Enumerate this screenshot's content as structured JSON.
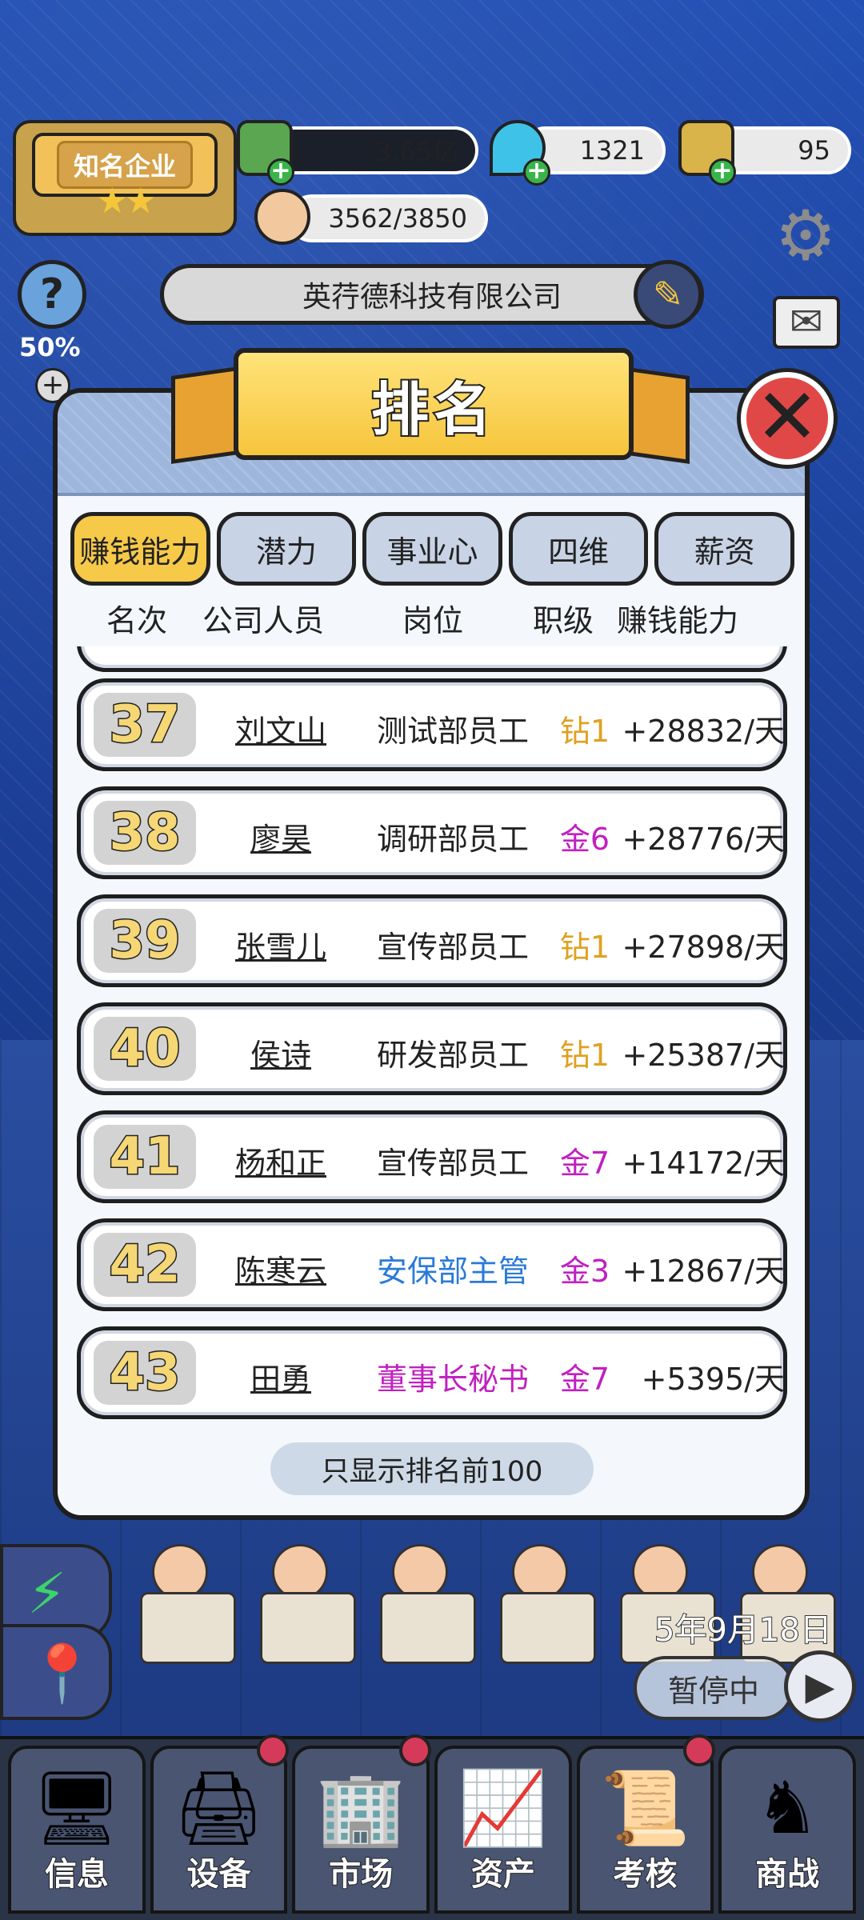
{
  "hud": {
    "company_rank_badge": "知名企业",
    "money": "3.65亿",
    "diamonds": "1321",
    "tickets": "95",
    "likes": "3562/3850",
    "company_name": "英荇德科技有限公司",
    "help_percent": "50%"
  },
  "modal": {
    "title": "排名",
    "tabs": [
      {
        "label": "赚钱能力",
        "active": true
      },
      {
        "label": "潜力",
        "active": false
      },
      {
        "label": "事业心",
        "active": false
      },
      {
        "label": "四维",
        "active": false
      },
      {
        "label": "薪资",
        "active": false
      }
    ],
    "columns": [
      "名次",
      "公司人员",
      "岗位",
      "职级",
      "赚钱能力"
    ],
    "rows": [
      {
        "rank": "37",
        "name": "刘文山",
        "position": "测试部员工",
        "position_color": "#222222",
        "grade": "钻1",
        "grade_color": "#e0a020",
        "earning": "+28832/天"
      },
      {
        "rank": "38",
        "name": "廖昊",
        "position": "调研部员工",
        "position_color": "#222222",
        "grade": "金6",
        "grade_color": "#c020c0",
        "earning": "+28776/天"
      },
      {
        "rank": "39",
        "name": "张雪儿",
        "position": "宣传部员工",
        "position_color": "#222222",
        "grade": "钻1",
        "grade_color": "#e0a020",
        "earning": "+27898/天"
      },
      {
        "rank": "40",
        "name": "侯诗",
        "position": "研发部员工",
        "position_color": "#222222",
        "grade": "钻1",
        "grade_color": "#e0a020",
        "earning": "+25387/天"
      },
      {
        "rank": "41",
        "name": "杨和正",
        "position": "宣传部员工",
        "position_color": "#222222",
        "grade": "金7",
        "grade_color": "#c020c0",
        "earning": "+14172/天"
      },
      {
        "rank": "42",
        "name": "陈寒云",
        "position": "安保部主管",
        "position_color": "#2a7ad8",
        "grade": "金3",
        "grade_color": "#c020c0",
        "earning": "+12867/天"
      },
      {
        "rank": "43",
        "name": "田勇",
        "position": "董事长秘书",
        "position_color": "#c020c0",
        "grade": "金7",
        "grade_color": "#c020c0",
        "earning": "+5395/天"
      }
    ],
    "footer_note": "只显示排名前100"
  },
  "overlay": {
    "date": "5年9月18日",
    "pause_label": "暂停中"
  },
  "bottom_nav": [
    {
      "label": "信息",
      "icon": "monitor-icon",
      "dot": false
    },
    {
      "label": "设备",
      "icon": "printer-icon",
      "dot": true
    },
    {
      "label": "市场",
      "icon": "city-icon",
      "dot": true
    },
    {
      "label": "资产",
      "icon": "chart-up-icon",
      "dot": false
    },
    {
      "label": "考核",
      "icon": "document-icon",
      "dot": true
    },
    {
      "label": "商战",
      "icon": "chess-icon",
      "dot": false
    }
  ],
  "colors": {
    "tab_active": "#f6c949",
    "tab_inactive": "#c8d4e6",
    "rank_number": "#f6d775",
    "close_button": "#e04848"
  }
}
